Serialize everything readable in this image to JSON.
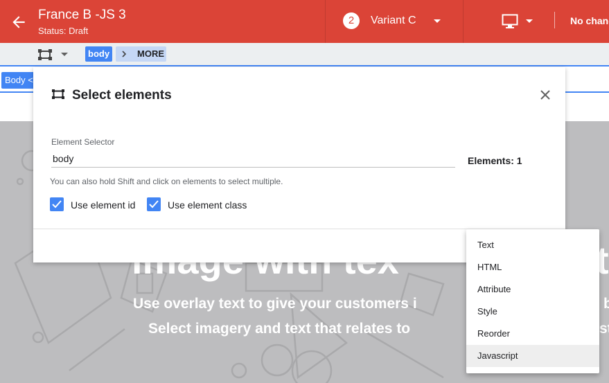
{
  "header": {
    "experiment_title": "France B -JS 3",
    "status": "Status: Draft",
    "variant_number": "2",
    "variant_name": "Variant C",
    "changes_label": "No chang",
    "brand_color": "#db4437"
  },
  "toolbar": {
    "selector_chip": "body",
    "more_chip": "MORE"
  },
  "page": {
    "body_tag": "Body <",
    "hero_title": "image with tex",
    "hero_line1": "Use overlay text to give your customers i",
    "hero_line2": "Select imagery and text that relates to",
    "hero_title_tail": "t",
    "hero_line1_tail": "b",
    "hero_line2_tail": "st"
  },
  "dialog": {
    "title": "Select elements",
    "field_label": "Element Selector",
    "field_value": "body",
    "elements_count": "Elements: 1",
    "hint": "You can also hold Shift and click on elements to select multiple.",
    "checkbox_id_label": "Use element id",
    "checkbox_class_label": "Use element class",
    "checkbox_id_checked": true,
    "checkbox_class_checked": true
  },
  "menu": {
    "items": [
      "Text",
      "HTML",
      "Attribute",
      "Style",
      "Reorder",
      "Javascript"
    ],
    "highlighted": "Javascript"
  },
  "icons": {
    "back": "arrow-back-icon",
    "device": "desktop-icon",
    "select": "select-element-icon",
    "close": "close-icon",
    "check": "check-icon"
  }
}
